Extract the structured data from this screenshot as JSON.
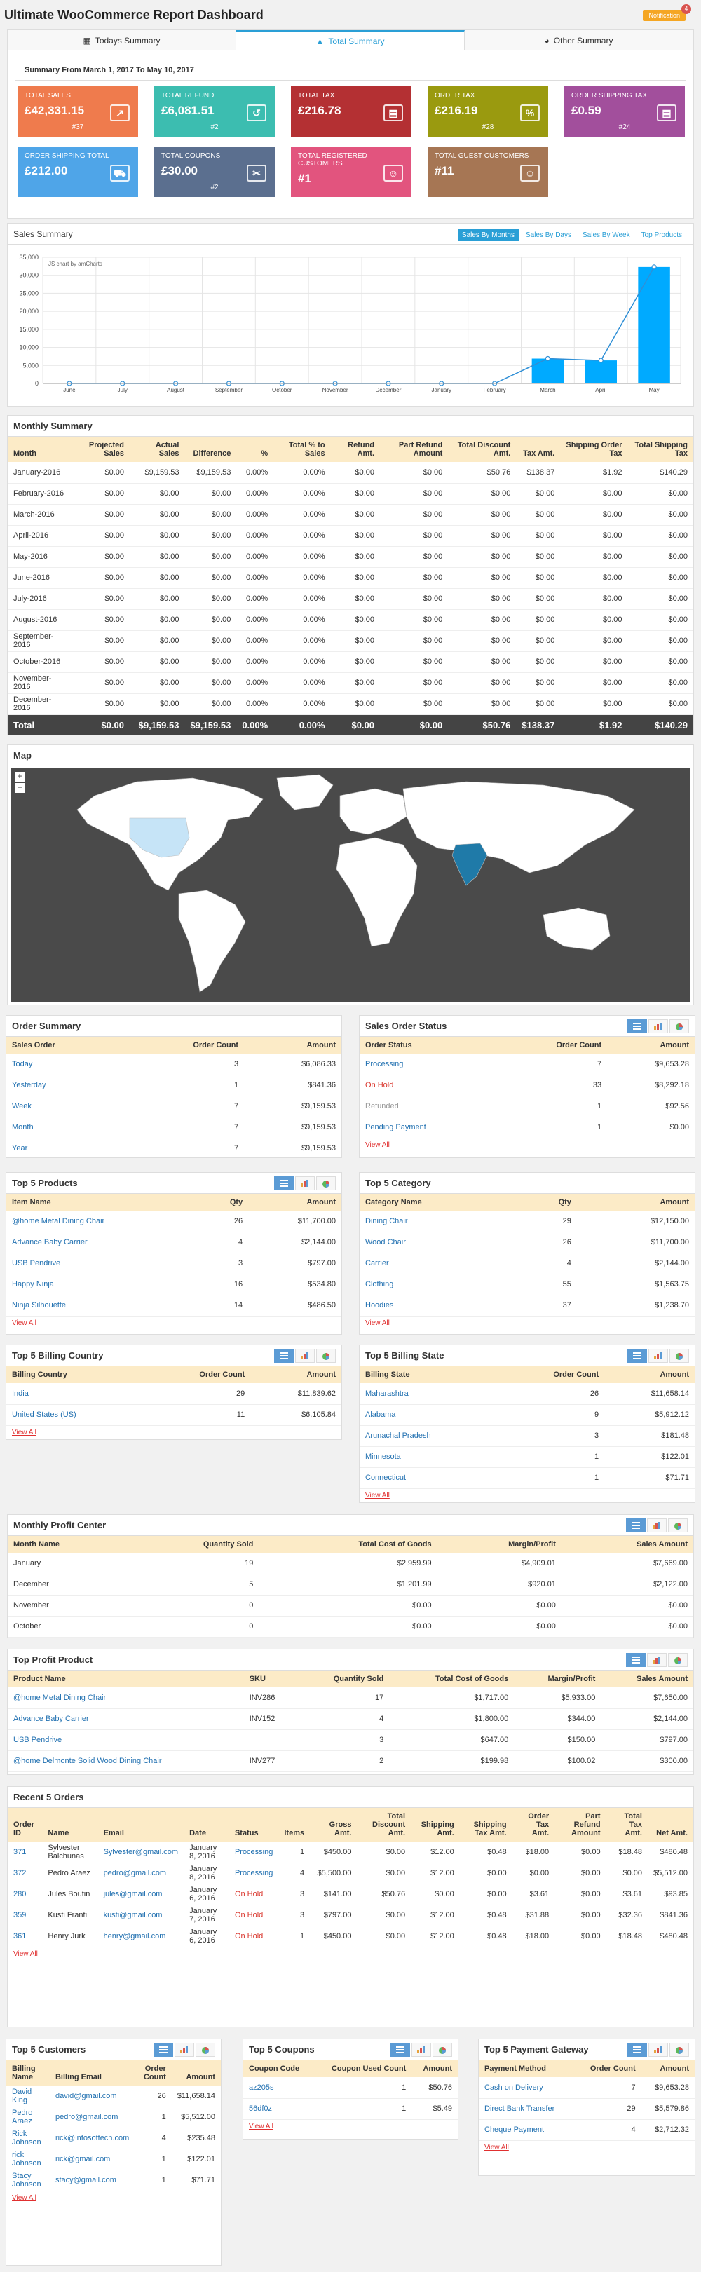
{
  "header": {
    "title": "Ultimate WooCommerce Report Dashboard",
    "notification_label": "Notification",
    "notification_count": "4"
  },
  "tabs": [
    {
      "label": "Todays Summary"
    },
    {
      "label": "Total Summary"
    },
    {
      "label": "Other Summary"
    }
  ],
  "summary": {
    "range": "Summary From March 1, 2017 To May 10, 2017",
    "cards": [
      {
        "label": "Total Sales",
        "value": "£42,331.15",
        "sub": "#37",
        "color": "#ef7b4d",
        "icon": "chart-up-icon",
        "glyph": "↗"
      },
      {
        "label": "Total Refund",
        "value": "£6,081.51",
        "sub": "#2",
        "color": "#3cbdb0",
        "icon": "refund-icon",
        "glyph": "↺"
      },
      {
        "label": "Total Tax",
        "value": "£216.78",
        "sub": "",
        "color": "#b43033",
        "icon": "receipt-icon",
        "glyph": "▤"
      },
      {
        "label": "Order Tax",
        "value": "£216.19",
        "sub": "#28",
        "color": "#9a9a0f",
        "icon": "percent-icon",
        "glyph": "%"
      },
      {
        "label": "Order Shipping Tax",
        "value": "£0.59",
        "sub": "#24",
        "color": "#a24f9c",
        "icon": "tax-doc-icon",
        "glyph": "▤"
      },
      {
        "label": "Order Shipping Total",
        "value": "£212.00",
        "sub": "",
        "color": "#4fa5e8",
        "icon": "truck-icon",
        "glyph": "⛟"
      },
      {
        "label": "Total Coupons",
        "value": "£30.00",
        "sub": "#2",
        "color": "#5b6f8f",
        "icon": "scissors-icon",
        "glyph": "✂"
      },
      {
        "label": "Total Registered Customers",
        "value": "#1",
        "sub": "",
        "color": "#e2547e",
        "icon": "users-icon",
        "glyph": "☺"
      },
      {
        "label": "Total Guest Customers",
        "value": "#11",
        "sub": "",
        "color": "#a67654",
        "icon": "guests-icon",
        "glyph": "☺"
      }
    ]
  },
  "sales_summary": {
    "title": "Sales Summary",
    "buttons": [
      "Sales By Months",
      "Sales By Days",
      "Sales By Week",
      "Top Products"
    ],
    "watermark": "JS chart by amCharts"
  },
  "chart_data": {
    "type": "bar",
    "categories": [
      "June",
      "July",
      "August",
      "September",
      "October",
      "November",
      "December",
      "January",
      "February",
      "March",
      "April",
      "May"
    ],
    "series": [
      {
        "values": [
          0,
          0,
          0,
          0,
          0,
          0,
          0,
          0,
          0,
          6900,
          6400,
          32300
        ]
      },
      {
        "values": [
          0,
          0,
          0,
          0,
          0,
          0,
          0,
          0,
          0,
          6900,
          6400,
          32300
        ]
      }
    ],
    "ylim": [
      0,
      35000
    ],
    "yticks": [
      "35,000",
      "30,000",
      "25,000",
      "20,000",
      "15,000",
      "10,000",
      "5,000",
      "0"
    ],
    "grid": true,
    "colors": [
      "#00aaff",
      "#2f8fd6"
    ]
  },
  "monthly": {
    "title": "Monthly Summary",
    "headers": [
      "Month",
      "Projected Sales",
      "Actual Sales",
      "Difference",
      "%",
      "Total % to Sales",
      "Refund Amt.",
      "Part Refund Amount",
      "Total Discount Amt.",
      "Tax Amt.",
      "Shipping Order Tax",
      "Total Shipping Tax"
    ],
    "rows": [
      [
        "January-2016",
        "$0.00",
        "$9,159.53",
        "$9,159.53",
        "0.00%",
        "0.00%",
        "$0.00",
        "$0.00",
        "$50.76",
        "$138.37",
        "$1.92",
        "$140.29"
      ],
      [
        "February-2016",
        "$0.00",
        "$0.00",
        "$0.00",
        "0.00%",
        "0.00%",
        "$0.00",
        "$0.00",
        "$0.00",
        "$0.00",
        "$0.00",
        "$0.00"
      ],
      [
        "March-2016",
        "$0.00",
        "$0.00",
        "$0.00",
        "0.00%",
        "0.00%",
        "$0.00",
        "$0.00",
        "$0.00",
        "$0.00",
        "$0.00",
        "$0.00"
      ],
      [
        "April-2016",
        "$0.00",
        "$0.00",
        "$0.00",
        "0.00%",
        "0.00%",
        "$0.00",
        "$0.00",
        "$0.00",
        "$0.00",
        "$0.00",
        "$0.00"
      ],
      [
        "May-2016",
        "$0.00",
        "$0.00",
        "$0.00",
        "0.00%",
        "0.00%",
        "$0.00",
        "$0.00",
        "$0.00",
        "$0.00",
        "$0.00",
        "$0.00"
      ],
      [
        "June-2016",
        "$0.00",
        "$0.00",
        "$0.00",
        "0.00%",
        "0.00%",
        "$0.00",
        "$0.00",
        "$0.00",
        "$0.00",
        "$0.00",
        "$0.00"
      ],
      [
        "July-2016",
        "$0.00",
        "$0.00",
        "$0.00",
        "0.00%",
        "0.00%",
        "$0.00",
        "$0.00",
        "$0.00",
        "$0.00",
        "$0.00",
        "$0.00"
      ],
      [
        "August-2016",
        "$0.00",
        "$0.00",
        "$0.00",
        "0.00%",
        "0.00%",
        "$0.00",
        "$0.00",
        "$0.00",
        "$0.00",
        "$0.00",
        "$0.00"
      ],
      [
        "September-2016",
        "$0.00",
        "$0.00",
        "$0.00",
        "0.00%",
        "0.00%",
        "$0.00",
        "$0.00",
        "$0.00",
        "$0.00",
        "$0.00",
        "$0.00"
      ],
      [
        "October-2016",
        "$0.00",
        "$0.00",
        "$0.00",
        "0.00%",
        "0.00%",
        "$0.00",
        "$0.00",
        "$0.00",
        "$0.00",
        "$0.00",
        "$0.00"
      ],
      [
        "November-2016",
        "$0.00",
        "$0.00",
        "$0.00",
        "0.00%",
        "0.00%",
        "$0.00",
        "$0.00",
        "$0.00",
        "$0.00",
        "$0.00",
        "$0.00"
      ],
      [
        "December-2016",
        "$0.00",
        "$0.00",
        "$0.00",
        "0.00%",
        "0.00%",
        "$0.00",
        "$0.00",
        "$0.00",
        "$0.00",
        "$0.00",
        "$0.00"
      ]
    ],
    "total": [
      "Total",
      "$0.00",
      "$9,159.53",
      "$9,159.53",
      "0.00%",
      "0.00%",
      "$0.00",
      "$0.00",
      "$50.76",
      "$138.37",
      "$1.92",
      "$140.29"
    ]
  },
  "map": {
    "title": "Map",
    "zoom_in": "+",
    "zoom_out": "−"
  },
  "order_summary": {
    "title": "Order Summary",
    "headers": [
      "Sales Order",
      "Order Count",
      "Amount"
    ],
    "rows": [
      [
        "Today",
        "3",
        "$6,086.33"
      ],
      [
        "Yesterday",
        "1",
        "$841.36"
      ],
      [
        "Week",
        "7",
        "$9,159.53"
      ],
      [
        "Month",
        "7",
        "$9,159.53"
      ],
      [
        "Year",
        "7",
        "$9,159.53"
      ]
    ]
  },
  "sales_order_status": {
    "title": "Sales Order Status",
    "headers": [
      "Order Status",
      "Order Count",
      "Amount"
    ],
    "rows": [
      [
        "Processing",
        "7",
        "$9,653.28"
      ],
      [
        "On Hold",
        "33",
        "$8,292.18"
      ],
      [
        "Refunded",
        "1",
        "$92.56"
      ],
      [
        "Pending Payment",
        "1",
        "$0.00"
      ]
    ],
    "view_all": "View All"
  },
  "top_products": {
    "title": "Top 5 Products",
    "headers": [
      "Item Name",
      "Qty",
      "Amount"
    ],
    "rows": [
      [
        "@home Metal Dining Chair",
        "26",
        "$11,700.00"
      ],
      [
        "Advance Baby Carrier",
        "4",
        "$2,144.00"
      ],
      [
        "USB Pendrive",
        "3",
        "$797.00"
      ],
      [
        "Happy Ninja",
        "16",
        "$534.80"
      ],
      [
        "Ninja Silhouette",
        "14",
        "$486.50"
      ]
    ],
    "view_all": "View All"
  },
  "top_category": {
    "title": "Top 5 Category",
    "headers": [
      "Category Name",
      "Qty",
      "Amount"
    ],
    "rows": [
      [
        "Dining Chair",
        "29",
        "$12,150.00"
      ],
      [
        "Wood Chair",
        "26",
        "$11,700.00"
      ],
      [
        "Carrier",
        "4",
        "$2,144.00"
      ],
      [
        "Clothing",
        "55",
        "$1,563.75"
      ],
      [
        "Hoodies",
        "37",
        "$1,238.70"
      ]
    ],
    "view_all": "View All"
  },
  "top_billing_country": {
    "title": "Top 5 Billing Country",
    "headers": [
      "Billing Country",
      "Order Count",
      "Amount"
    ],
    "rows": [
      [
        "India",
        "29",
        "$11,839.62"
      ],
      [
        "United States (US)",
        "11",
        "$6,105.84"
      ]
    ],
    "view_all": "View All"
  },
  "top_billing_state": {
    "title": "Top 5 Billing State",
    "headers": [
      "Billing State",
      "Order Count",
      "Amount"
    ],
    "rows": [
      [
        "Maharashtra",
        "26",
        "$11,658.14"
      ],
      [
        "Alabama",
        "9",
        "$5,912.12"
      ],
      [
        "Arunachal Pradesh",
        "3",
        "$181.48"
      ],
      [
        "Minnesota",
        "1",
        "$122.01"
      ],
      [
        "Connecticut",
        "1",
        "$71.71"
      ]
    ],
    "view_all": "View All"
  },
  "monthly_profit": {
    "title": "Monthly Profit Center",
    "headers": [
      "Month Name",
      "Quantity Sold",
      "Total Cost of Goods",
      "Margin/Profit",
      "Sales Amount"
    ],
    "rows": [
      [
        "January",
        "19",
        "$2,959.99",
        "$4,909.01",
        "$7,669.00"
      ],
      [
        "December",
        "5",
        "$1,201.99",
        "$920.01",
        "$2,122.00"
      ],
      [
        "November",
        "0",
        "$0.00",
        "$0.00",
        "$0.00"
      ],
      [
        "October",
        "0",
        "$0.00",
        "$0.00",
        "$0.00"
      ]
    ]
  },
  "top_profit_product": {
    "title": "Top Profit Product",
    "headers": [
      "Product Name",
      "SKU",
      "Quantity Sold",
      "Total Cost of Goods",
      "Margin/Profit",
      "Sales Amount"
    ],
    "rows": [
      [
        "@home Metal Dining Chair",
        "INV286",
        "17",
        "$1,717.00",
        "$5,933.00",
        "$7,650.00"
      ],
      [
        "Advance Baby Carrier",
        "INV152",
        "4",
        "$1,800.00",
        "$344.00",
        "$2,144.00"
      ],
      [
        "USB Pendrive",
        "",
        "3",
        "$647.00",
        "$150.00",
        "$797.00"
      ],
      [
        "@home Delmonte Solid Wood Dining Chair",
        "INV277",
        "2",
        "$199.98",
        "$100.02",
        "$300.00"
      ]
    ]
  },
  "recent_orders": {
    "title": "Recent 5 Orders",
    "headers": [
      "Order ID",
      "Name",
      "Email",
      "Date",
      "Status",
      "Items",
      "Gross Amt.",
      "Total Discount Amt.",
      "Shipping Amt.",
      "Shipping Tax Amt.",
      "Order Tax Amt.",
      "Part Refund Amount",
      "Total Tax Amt.",
      "Net Amt."
    ],
    "rows": [
      [
        "371",
        "Sylvester Balchunas",
        "Sylvester@gmail.com",
        "January 8, 2016",
        "Processing",
        "1",
        "$450.00",
        "$0.00",
        "$12.00",
        "$0.48",
        "$18.00",
        "$0.00",
        "$18.48",
        "$480.48"
      ],
      [
        "372",
        "Pedro Araez",
        "pedro@gmail.com",
        "January 8, 2016",
        "Processing",
        "4",
        "$5,500.00",
        "$0.00",
        "$12.00",
        "$0.00",
        "$0.00",
        "$0.00",
        "$0.00",
        "$5,512.00"
      ],
      [
        "280",
        "Jules Boutin",
        "jules@gmail.com",
        "January 6, 2016",
        "On Hold",
        "3",
        "$141.00",
        "$50.76",
        "$0.00",
        "$0.00",
        "$3.61",
        "$0.00",
        "$3.61",
        "$93.85"
      ],
      [
        "359",
        "Kusti Franti",
        "kusti@gmail.com",
        "January 7, 2016",
        "On Hold",
        "3",
        "$797.00",
        "$0.00",
        "$12.00",
        "$0.48",
        "$31.88",
        "$0.00",
        "$32.36",
        "$841.36"
      ],
      [
        "361",
        "Henry Jurk",
        "henry@gmail.com",
        "January 6, 2016",
        "On Hold",
        "1",
        "$450.00",
        "$0.00",
        "$12.00",
        "$0.48",
        "$18.00",
        "$0.00",
        "$18.48",
        "$480.48"
      ]
    ],
    "view_all": "View All"
  },
  "top_customers": {
    "title": "Top 5 Customers",
    "headers": [
      "Billing Name",
      "Billing Email",
      "Order Count",
      "Amount"
    ],
    "rows": [
      [
        "David King",
        "david@gmail.com",
        "26",
        "$11,658.14"
      ],
      [
        "Pedro Araez",
        "pedro@gmail.com",
        "1",
        "$5,512.00"
      ],
      [
        "Rick Johnson",
        "rick@infosottech.com",
        "4",
        "$235.48"
      ],
      [
        "rick Johnson",
        "rick@gmail.com",
        "1",
        "$122.01"
      ],
      [
        "Stacy Johnson",
        "stacy@gmail.com",
        "1",
        "$71.71"
      ]
    ],
    "view_all": "View All"
  },
  "top_coupons": {
    "title": "Top 5 Coupons",
    "headers": [
      "Coupon Code",
      "Coupon Used Count",
      "Amount"
    ],
    "rows": [
      [
        "az205s",
        "1",
        "$50.76"
      ],
      [
        "56df0z",
        "1",
        "$5.49"
      ]
    ],
    "view_all": "View All"
  },
  "top_payment": {
    "title": "Top 5 Payment Gateway",
    "headers": [
      "Payment Method",
      "Order Count",
      "Amount"
    ],
    "rows": [
      [
        "Cash on Delivery",
        "7",
        "$9,653.28"
      ],
      [
        "Direct Bank Transfer",
        "29",
        "$5,579.86"
      ],
      [
        "Cheque Payment",
        "4",
        "$2,712.32"
      ]
    ],
    "view_all": "View All"
  }
}
